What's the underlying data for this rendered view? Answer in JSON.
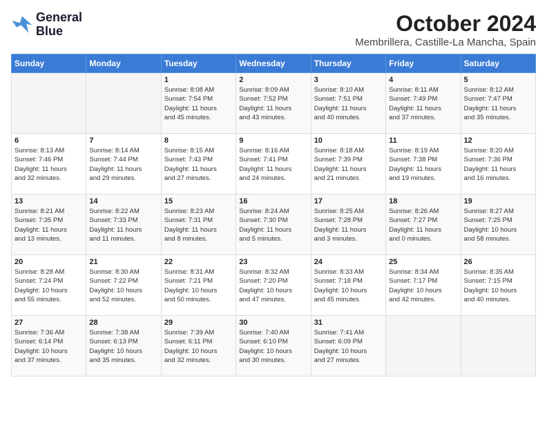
{
  "header": {
    "logo_line1": "General",
    "logo_line2": "Blue",
    "month_title": "October 2024",
    "location": "Membrillera, Castille-La Mancha, Spain"
  },
  "weekdays": [
    "Sunday",
    "Monday",
    "Tuesday",
    "Wednesday",
    "Thursday",
    "Friday",
    "Saturday"
  ],
  "weeks": [
    [
      {
        "day": "",
        "info": ""
      },
      {
        "day": "",
        "info": ""
      },
      {
        "day": "1",
        "info": "Sunrise: 8:08 AM\nSunset: 7:54 PM\nDaylight: 11 hours\nand 45 minutes."
      },
      {
        "day": "2",
        "info": "Sunrise: 8:09 AM\nSunset: 7:52 PM\nDaylight: 11 hours\nand 43 minutes."
      },
      {
        "day": "3",
        "info": "Sunrise: 8:10 AM\nSunset: 7:51 PM\nDaylight: 11 hours\nand 40 minutes."
      },
      {
        "day": "4",
        "info": "Sunrise: 8:11 AM\nSunset: 7:49 PM\nDaylight: 11 hours\nand 37 minutes."
      },
      {
        "day": "5",
        "info": "Sunrise: 8:12 AM\nSunset: 7:47 PM\nDaylight: 11 hours\nand 35 minutes."
      }
    ],
    [
      {
        "day": "6",
        "info": "Sunrise: 8:13 AM\nSunset: 7:46 PM\nDaylight: 11 hours\nand 32 minutes."
      },
      {
        "day": "7",
        "info": "Sunrise: 8:14 AM\nSunset: 7:44 PM\nDaylight: 11 hours\nand 29 minutes."
      },
      {
        "day": "8",
        "info": "Sunrise: 8:15 AM\nSunset: 7:43 PM\nDaylight: 11 hours\nand 27 minutes."
      },
      {
        "day": "9",
        "info": "Sunrise: 8:16 AM\nSunset: 7:41 PM\nDaylight: 11 hours\nand 24 minutes."
      },
      {
        "day": "10",
        "info": "Sunrise: 8:18 AM\nSunset: 7:39 PM\nDaylight: 11 hours\nand 21 minutes."
      },
      {
        "day": "11",
        "info": "Sunrise: 8:19 AM\nSunset: 7:38 PM\nDaylight: 11 hours\nand 19 minutes."
      },
      {
        "day": "12",
        "info": "Sunrise: 8:20 AM\nSunset: 7:36 PM\nDaylight: 11 hours\nand 16 minutes."
      }
    ],
    [
      {
        "day": "13",
        "info": "Sunrise: 8:21 AM\nSunset: 7:35 PM\nDaylight: 11 hours\nand 13 minutes."
      },
      {
        "day": "14",
        "info": "Sunrise: 8:22 AM\nSunset: 7:33 PM\nDaylight: 11 hours\nand 11 minutes."
      },
      {
        "day": "15",
        "info": "Sunrise: 8:23 AM\nSunset: 7:31 PM\nDaylight: 11 hours\nand 8 minutes."
      },
      {
        "day": "16",
        "info": "Sunrise: 8:24 AM\nSunset: 7:30 PM\nDaylight: 11 hours\nand 5 minutes."
      },
      {
        "day": "17",
        "info": "Sunrise: 8:25 AM\nSunset: 7:28 PM\nDaylight: 11 hours\nand 3 minutes."
      },
      {
        "day": "18",
        "info": "Sunrise: 8:26 AM\nSunset: 7:27 PM\nDaylight: 11 hours\nand 0 minutes."
      },
      {
        "day": "19",
        "info": "Sunrise: 8:27 AM\nSunset: 7:25 PM\nDaylight: 10 hours\nand 58 minutes."
      }
    ],
    [
      {
        "day": "20",
        "info": "Sunrise: 8:28 AM\nSunset: 7:24 PM\nDaylight: 10 hours\nand 55 minutes."
      },
      {
        "day": "21",
        "info": "Sunrise: 8:30 AM\nSunset: 7:22 PM\nDaylight: 10 hours\nand 52 minutes."
      },
      {
        "day": "22",
        "info": "Sunrise: 8:31 AM\nSunset: 7:21 PM\nDaylight: 10 hours\nand 50 minutes."
      },
      {
        "day": "23",
        "info": "Sunrise: 8:32 AM\nSunset: 7:20 PM\nDaylight: 10 hours\nand 47 minutes."
      },
      {
        "day": "24",
        "info": "Sunrise: 8:33 AM\nSunset: 7:18 PM\nDaylight: 10 hours\nand 45 minutes."
      },
      {
        "day": "25",
        "info": "Sunrise: 8:34 AM\nSunset: 7:17 PM\nDaylight: 10 hours\nand 42 minutes."
      },
      {
        "day": "26",
        "info": "Sunrise: 8:35 AM\nSunset: 7:15 PM\nDaylight: 10 hours\nand 40 minutes."
      }
    ],
    [
      {
        "day": "27",
        "info": "Sunrise: 7:36 AM\nSunset: 6:14 PM\nDaylight: 10 hours\nand 37 minutes."
      },
      {
        "day": "28",
        "info": "Sunrise: 7:38 AM\nSunset: 6:13 PM\nDaylight: 10 hours\nand 35 minutes."
      },
      {
        "day": "29",
        "info": "Sunrise: 7:39 AM\nSunset: 6:11 PM\nDaylight: 10 hours\nand 32 minutes."
      },
      {
        "day": "30",
        "info": "Sunrise: 7:40 AM\nSunset: 6:10 PM\nDaylight: 10 hours\nand 30 minutes."
      },
      {
        "day": "31",
        "info": "Sunrise: 7:41 AM\nSunset: 6:09 PM\nDaylight: 10 hours\nand 27 minutes."
      },
      {
        "day": "",
        "info": ""
      },
      {
        "day": "",
        "info": ""
      }
    ]
  ]
}
